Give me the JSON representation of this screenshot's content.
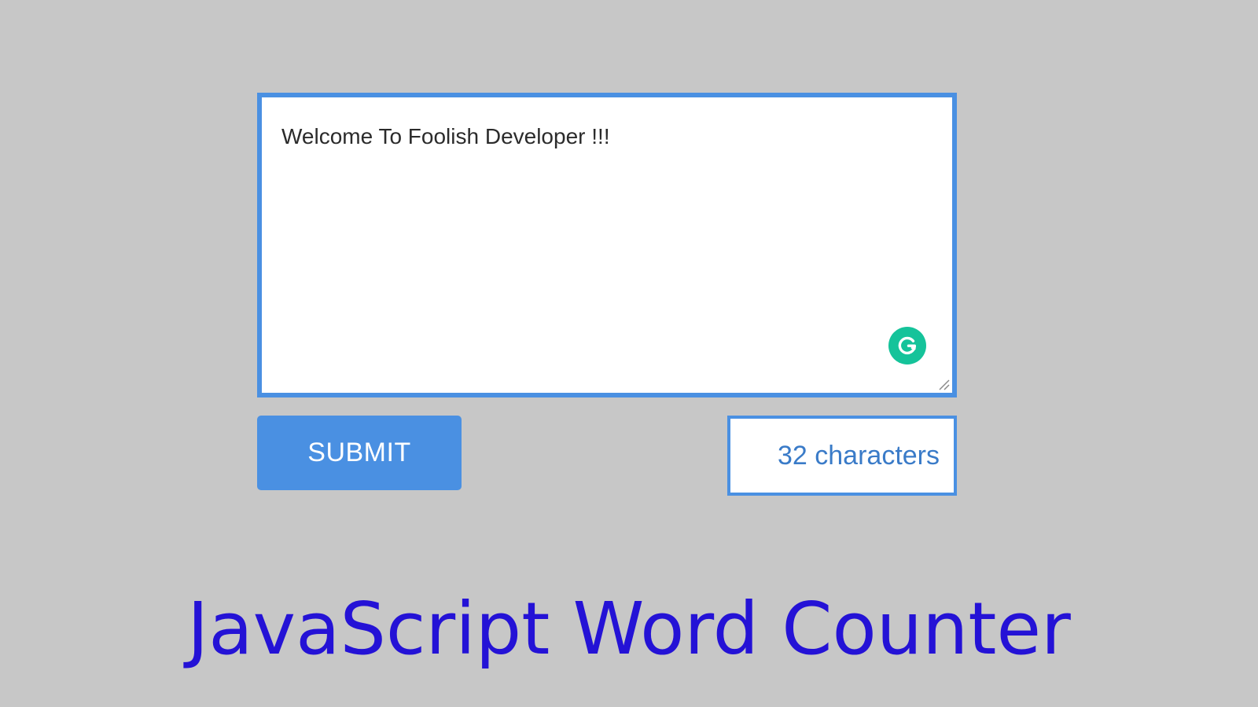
{
  "editor": {
    "text": "Welcome To Foolish Developer !!!",
    "grammarly_icon": "grammarly-g-icon",
    "resize_icon": "resize-grip-icon"
  },
  "actions": {
    "submit_label": "SUBMIT"
  },
  "counter": {
    "text": "32 characters"
  },
  "title": "JavaScript Word Counter",
  "colors": {
    "background": "#c7c7c7",
    "accent": "#4a90e2",
    "counter_text": "#3a7bc8",
    "grammarly": "#15c39a",
    "title": "#2412d6"
  }
}
